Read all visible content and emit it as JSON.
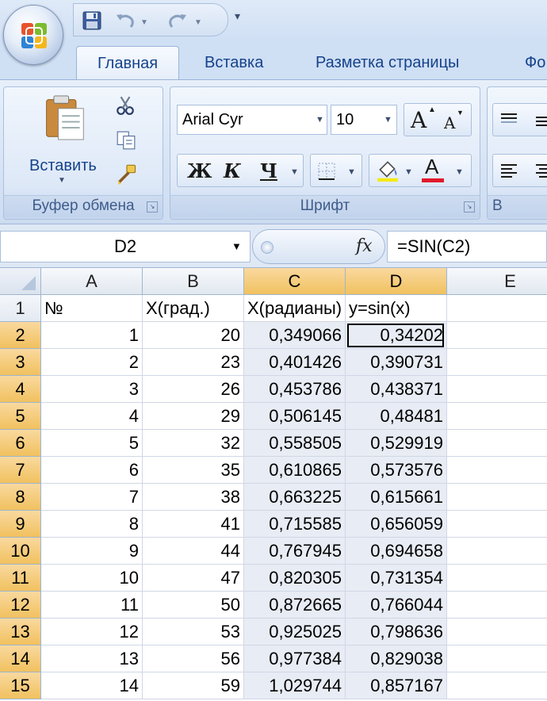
{
  "qat": {
    "icons": [
      "save-icon",
      "undo-icon",
      "redo-icon",
      "customize-qat-icon"
    ]
  },
  "tabs": [
    "Главная",
    "Вставка",
    "Разметка страницы",
    "Фо"
  ],
  "active_tab": "Главная",
  "ribbon": {
    "clipboard": {
      "label": "Буфер обмена",
      "paste_label": "Вставить"
    },
    "font": {
      "label": "Шрифт",
      "font_name": "Arial Cyr",
      "font_size": "10",
      "bold": "Ж",
      "italic": "К",
      "underline": "Ч",
      "grow_letter": "A",
      "shrink_letter": "A",
      "font_color_letter": "A"
    },
    "alignment": {
      "label": "В"
    }
  },
  "formula_bar": {
    "name_box": "D2",
    "fx": "fx",
    "formula": "=SIN(C2)"
  },
  "sheet": {
    "columns": [
      "A",
      "B",
      "C",
      "D",
      "E"
    ],
    "selected_columns": [
      "C",
      "D"
    ],
    "active_cell": "D2",
    "rows": [
      {
        "num": "1",
        "cells": [
          "№",
          "X(град.)",
          "X(радианы)",
          "y=sin(x)",
          ""
        ]
      },
      {
        "num": "2",
        "cells": [
          "1",
          "20",
          "0,349066",
          "0,34202",
          ""
        ]
      },
      {
        "num": "3",
        "cells": [
          "2",
          "23",
          "0,401426",
          "0,390731",
          ""
        ]
      },
      {
        "num": "4",
        "cells": [
          "3",
          "26",
          "0,453786",
          "0,438371",
          ""
        ]
      },
      {
        "num": "5",
        "cells": [
          "4",
          "29",
          "0,506145",
          "0,48481",
          ""
        ]
      },
      {
        "num": "6",
        "cells": [
          "5",
          "32",
          "0,558505",
          "0,529919",
          ""
        ]
      },
      {
        "num": "7",
        "cells": [
          "6",
          "35",
          "0,610865",
          "0,573576",
          ""
        ]
      },
      {
        "num": "8",
        "cells": [
          "7",
          "38",
          "0,663225",
          "0,615661",
          ""
        ]
      },
      {
        "num": "9",
        "cells": [
          "8",
          "41",
          "0,715585",
          "0,656059",
          ""
        ]
      },
      {
        "num": "10",
        "cells": [
          "9",
          "44",
          "0,767945",
          "0,694658",
          ""
        ]
      },
      {
        "num": "11",
        "cells": [
          "10",
          "47",
          "0,820305",
          "0,731354",
          ""
        ]
      },
      {
        "num": "12",
        "cells": [
          "11",
          "50",
          "0,872665",
          "0,766044",
          ""
        ]
      },
      {
        "num": "13",
        "cells": [
          "12",
          "53",
          "0,925025",
          "0,798636",
          ""
        ]
      },
      {
        "num": "14",
        "cells": [
          "13",
          "56",
          "0,977384",
          "0,829038",
          ""
        ]
      },
      {
        "num": "15",
        "cells": [
          "14",
          "59",
          "1,029744",
          "0,857167",
          ""
        ]
      }
    ]
  }
}
